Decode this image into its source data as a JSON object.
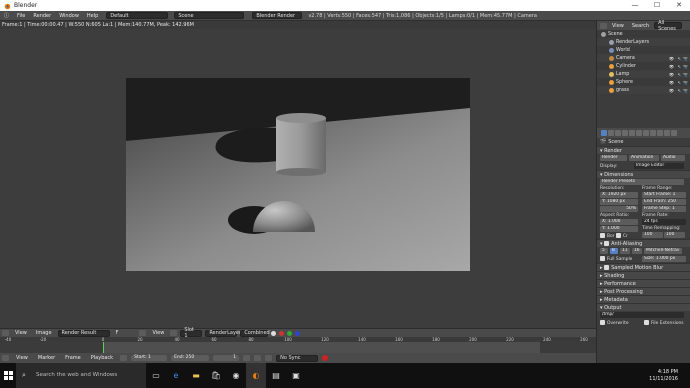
{
  "window": {
    "title": "Blender",
    "minimize": "—",
    "maximize": "☐",
    "close": "✕"
  },
  "menubar": {
    "items": [
      "File",
      "Render",
      "Window",
      "Help"
    ],
    "layout": "Default",
    "scene": "Scene",
    "engine": "Blender Render",
    "info": "v2.78 | Verts:550 | Faces:547 | Tris:1,086 | Objects:1/5 | Lamps:0/1 | Mem:45.77M | Camera"
  },
  "image_header": {
    "text": "Frame:1 | Time:00:00.47 | W:550 N:605 La:1 | Mem:140.77M, Peak: 142.96M"
  },
  "image_editor_header": {
    "view": "View",
    "image": "Image",
    "image_name": "Render Result",
    "f_label": "F",
    "view2": "View",
    "slot": "Slot 1",
    "layer": "RenderLayer",
    "pass": "Combined"
  },
  "timeline": {
    "ticks": [
      "-40",
      "-20",
      "0",
      "20",
      "40",
      "60",
      "80",
      "100",
      "120",
      "140",
      "160",
      "180",
      "200",
      "220",
      "240",
      "260"
    ],
    "view": "View",
    "marker": "Marker",
    "frame": "Frame",
    "playback": "Playback",
    "start_label": "Start:",
    "start": "1",
    "end_label": "End:",
    "end": "250",
    "current": "1",
    "sync": "No Sync"
  },
  "taskbar": {
    "search": "Search the web and Windows",
    "time": "4:18 PM",
    "date": "11/11/2016"
  },
  "outliner": {
    "view": "View",
    "search": "Search",
    "filter": "All Scenes",
    "items": [
      {
        "label": "Scene",
        "color": "#a0a0a0",
        "indent": 0
      },
      {
        "label": "RenderLayers",
        "color": "#9aa0b0",
        "indent": 1
      },
      {
        "label": "World",
        "color": "#7a8fb8",
        "indent": 1
      },
      {
        "label": "Camera",
        "color": "#c08a40",
        "indent": 1
      },
      {
        "label": "Cylinder",
        "color": "#e8a040",
        "indent": 1
      },
      {
        "label": "Lamp",
        "color": "#e0c060",
        "indent": 1
      },
      {
        "label": "Sphere",
        "color": "#e8a040",
        "indent": 1
      },
      {
        "label": "grass",
        "color": "#e8a040",
        "indent": 1
      }
    ],
    "eye": "👁",
    "arrow": "↖",
    "cam": "📷"
  },
  "properties": {
    "scene_label": "Scene",
    "render": {
      "title": "Render",
      "render_btn": "Render",
      "anim_btn": "Animation",
      "audio_btn": "Audio",
      "display_label": "Display:",
      "display_value": "Image Editor"
    },
    "dimensions": {
      "title": "Dimensions",
      "presets": "Render Presets",
      "resolution_label": "Resolution:",
      "x": "X:",
      "res_x": "1920 px",
      "y": "Y:",
      "res_y": "1080 px",
      "pct": "50%",
      "frame_range_label": "Frame Range:",
      "start": "Start Frame: 1",
      "end": "End Fram: 250",
      "step": "Frame Step: 1",
      "aspect_label": "Aspect Ratio:",
      "asp_x": "1.000",
      "asp_y": "1.000",
      "rate_label": "Frame Rate:",
      "rate": "24 fps",
      "remap_label": "Time Remapping:",
      "old": "100",
      "new": "100",
      "border": "Bor",
      "crop": "Cr"
    },
    "antialias": {
      "title": "Anti-Aliasing",
      "s5": "5",
      "s8": "8",
      "s11": "11",
      "s16": "16",
      "filter": "Mitchell-Netrav",
      "full_sample": "Full Sample",
      "size": "Size: 1.000 px"
    },
    "panels": [
      "Sampled Motion Blur",
      "Shading",
      "Performance",
      "Post Processing",
      "Metadata",
      "Output"
    ],
    "output": {
      "path": "/tmp/",
      "overwrite": "Overwrite",
      "file_ext": "File Extensions"
    }
  }
}
